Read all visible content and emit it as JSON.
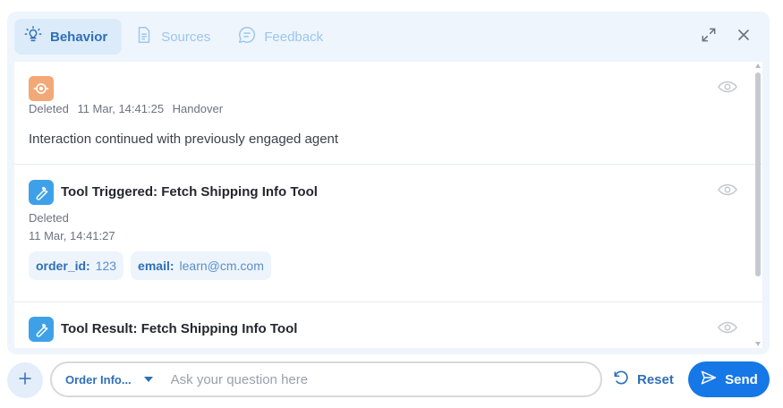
{
  "colors": {
    "accent": "#2f6fb8",
    "send_button": "#1677e6",
    "panel_bg": "#eef5fc",
    "handover_avatar": "#f3a877",
    "tool_icon": "#3ea1e8"
  },
  "tabs": [
    {
      "label": "Behavior",
      "icon": "lightbulb-icon",
      "active": true
    },
    {
      "label": "Sources",
      "icon": "document-icon",
      "active": false
    },
    {
      "label": "Feedback",
      "icon": "chat-bubble-icon",
      "active": false
    }
  ],
  "window_controls": {
    "expand_icon": "expand-icon",
    "close_icon": "close-icon"
  },
  "entries": [
    {
      "icon": "handover-avatar-icon",
      "status": "Deleted",
      "timestamp": "11 Mar, 14:41:25",
      "type": "Handover",
      "message": "Interaction continued with previously engaged agent"
    },
    {
      "icon": "wrench-icon",
      "title": "Tool Triggered: Fetch Shipping Info Tool",
      "status": "Deleted",
      "timestamp": "11 Mar, 14:41:27",
      "params": [
        {
          "key": "order_id:",
          "value": "123"
        },
        {
          "key": "email:",
          "value": "learn@cm.com"
        }
      ]
    },
    {
      "icon": "wrench-icon",
      "title": "Tool Result: Fetch Shipping Info Tool"
    }
  ],
  "composer": {
    "add_icon": "plus-icon",
    "selector_label": "Order Info...",
    "input_placeholder": "Ask your question here",
    "input_value": "",
    "reset_label": "Reset",
    "send_label": "Send"
  }
}
